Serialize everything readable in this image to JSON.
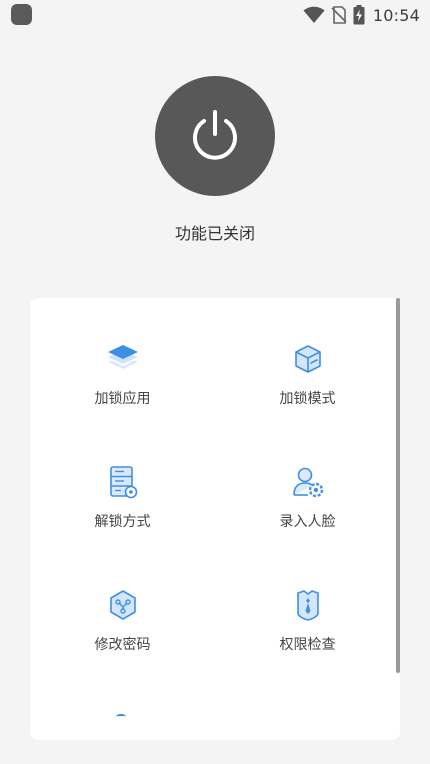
{
  "status_bar": {
    "time": "10:54",
    "icons": [
      "app-icon",
      "wifi-icon",
      "no-sim-icon",
      "battery-charging-icon"
    ]
  },
  "power": {
    "icon": "power-icon",
    "status": "功能已关闭"
  },
  "colors": {
    "power_bg": "#585858",
    "accent": "#3d8fe6",
    "background": "#f4f4f4",
    "card": "#ffffff"
  },
  "menu": {
    "items": [
      {
        "label": "加锁应用",
        "icon": "layers-icon"
      },
      {
        "label": "加锁模式",
        "icon": "cube-icon"
      },
      {
        "label": "解锁方式",
        "icon": "server-gear-icon"
      },
      {
        "label": "录入人脸",
        "icon": "user-gear-icon"
      },
      {
        "label": "修改密码",
        "icon": "hexagon-key-icon"
      },
      {
        "label": "权限检查",
        "icon": "badge-tie-icon"
      }
    ]
  }
}
